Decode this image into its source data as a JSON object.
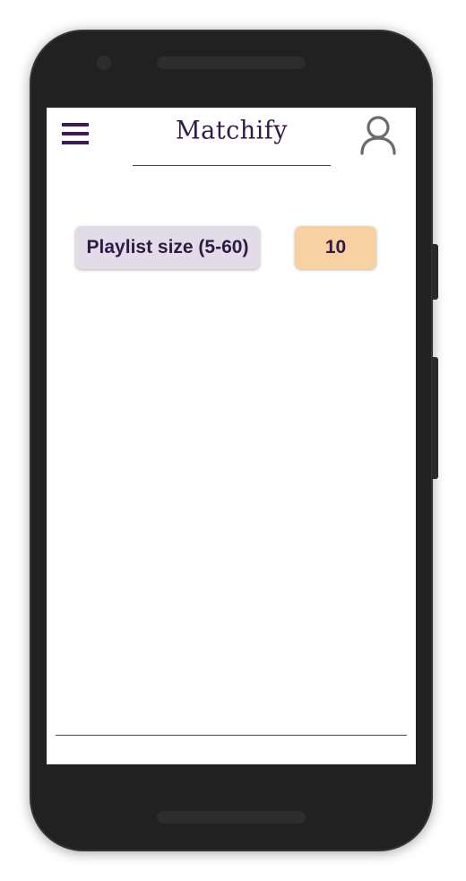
{
  "header": {
    "app_title": "Matchify",
    "menu_icon": "hamburger-menu-icon",
    "account_icon": "user-account-icon"
  },
  "settings": {
    "playlist_size_label": "Playlist size (5-60)",
    "playlist_size_value": "10"
  },
  "colors": {
    "brand_purple": "#3a1a5a",
    "label_bg": "#e2dbe8",
    "value_bg": "#f8d1a2",
    "phone_frame": "#212121"
  }
}
